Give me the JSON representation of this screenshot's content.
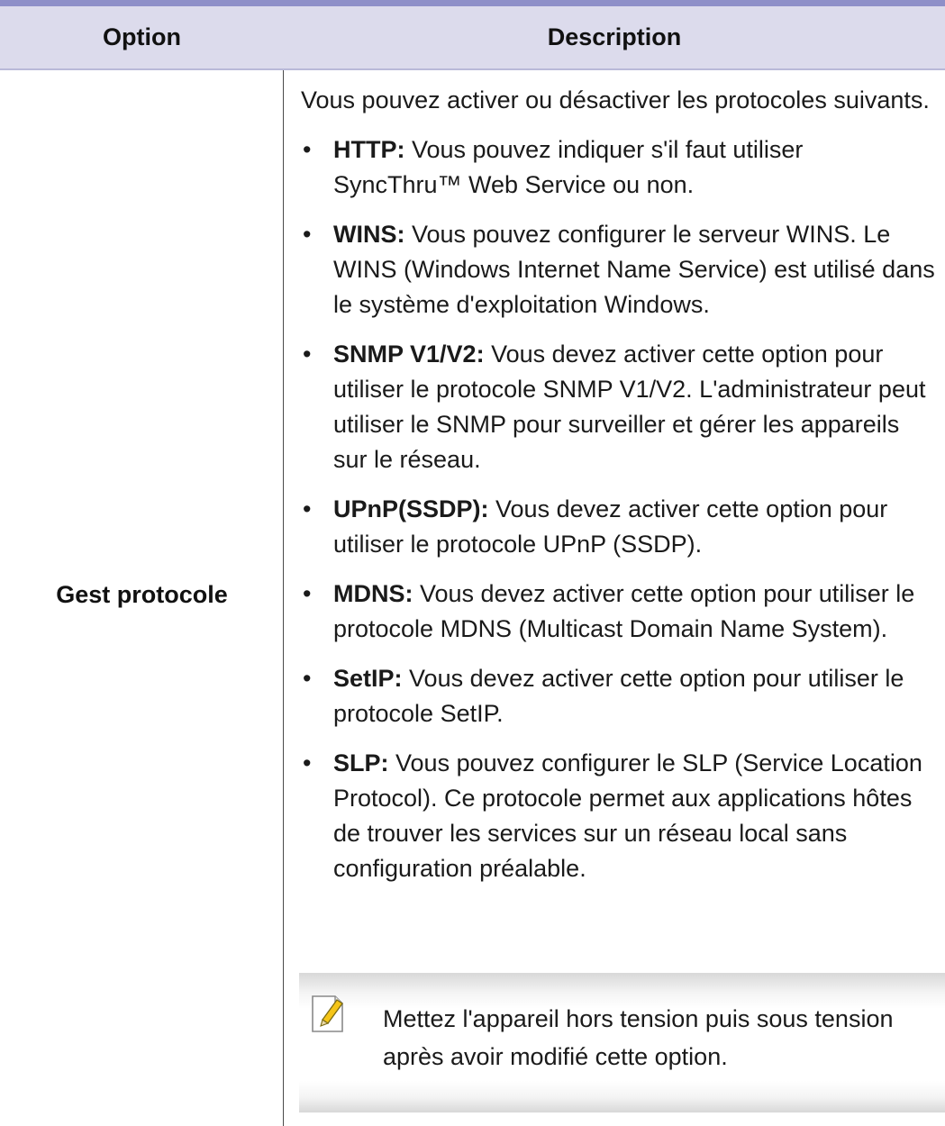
{
  "table": {
    "header": {
      "option": "Option",
      "description": "Description"
    },
    "row": {
      "option": "Gest protocole",
      "intro": "Vous pouvez activer ou désactiver les protocoles suivants.",
      "items": [
        {
          "term": "HTTP:",
          "text": " Vous pouvez indiquer s'il faut utiliser SyncThru™ Web Service ou non."
        },
        {
          "term": "WINS:",
          "text": " Vous pouvez configurer le serveur WINS. Le WINS (Windows Internet Name Service) est utilisé dans le système d'exploitation Windows."
        },
        {
          "term": "SNMP V1/V2:",
          "text": " Vous devez activer cette option pour utiliser le protocole SNMP V1/V2. L'administrateur peut utiliser le SNMP pour surveiller et gérer les appareils sur le réseau."
        },
        {
          "term": "UPnP(SSDP):",
          "text": " Vous devez activer cette option pour utiliser le protocole UPnP (SSDP)."
        },
        {
          "term": "MDNS:",
          "text": " Vous devez activer cette option pour utiliser le protocole MDNS (Multicast Domain Name System)."
        },
        {
          "term": "SetIP:",
          "text": " Vous devez activer cette option pour utiliser le protocole SetIP."
        },
        {
          "term": "SLP:",
          "text": " Vous pouvez configurer le SLP (Service Location Protocol). Ce protocole permet aux applications hôtes de trouver les services sur un réseau local sans configuration préalable."
        }
      ],
      "note": {
        "icon": "note-pencil-icon",
        "text": "Mettez l'appareil hors tension puis sous tension après avoir modifié cette option."
      }
    }
  },
  "colors": {
    "top_rule": "#8e8fc8",
    "header_bg": "#dcdbec",
    "note_icon": "#f5c518"
  }
}
